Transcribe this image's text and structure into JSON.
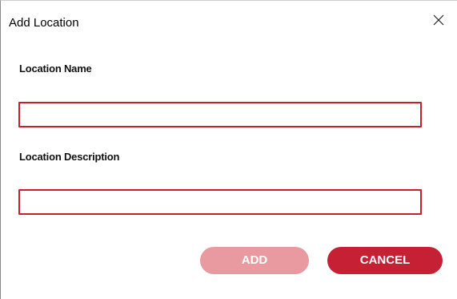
{
  "dialog": {
    "title": "Add Location",
    "close_icon": "close-icon"
  },
  "form": {
    "name_label": "Location Name",
    "name_value": "",
    "description_label": "Location Description",
    "description_value": ""
  },
  "buttons": {
    "add_label": "ADD",
    "add_disabled": true,
    "cancel_label": "CANCEL"
  },
  "colors": {
    "accent": "#c52033",
    "accent_disabled": "#e89aa0",
    "input_border": "#c4202f"
  }
}
